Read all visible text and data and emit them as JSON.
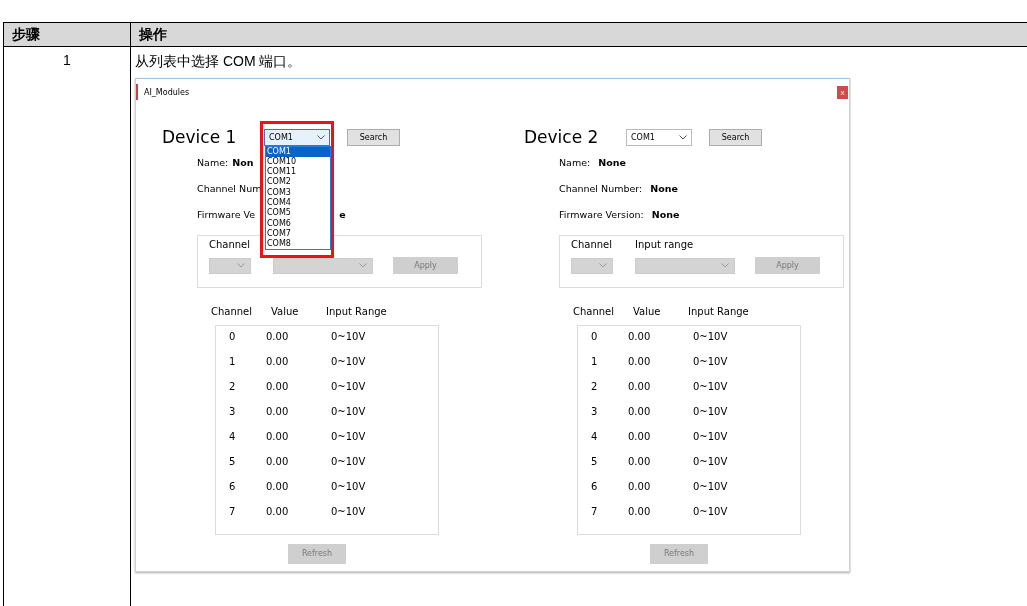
{
  "table": {
    "columns": [
      "步骤",
      "操作"
    ],
    "rows": [
      {
        "step": "1",
        "instruction": "从列表中选择 COM 端口。",
        "screenshot": {
          "window": {
            "title": "AI_Modules",
            "close": "x"
          },
          "devices": [
            {
              "title": "Device 1",
              "port": {
                "value": "COM1",
                "open": true,
                "highlighted": true,
                "options": [
                  {
                    "label": "COM1",
                    "selected": true
                  },
                  {
                    "label": "COM10",
                    "selected": false
                  },
                  {
                    "label": "COM11",
                    "selected": false
                  },
                  {
                    "label": "COM2",
                    "selected": false
                  },
                  {
                    "label": "COM3",
                    "selected": false
                  },
                  {
                    "label": "COM4",
                    "selected": false
                  },
                  {
                    "label": "COM5",
                    "selected": false
                  },
                  {
                    "label": "COM6",
                    "selected": false
                  },
                  {
                    "label": "COM7",
                    "selected": false
                  },
                  {
                    "label": "COM8",
                    "selected": false
                  }
                ]
              },
              "search_button": "Search",
              "info": [
                {
                  "label": "Name:",
                  "value": "Non"
                },
                {
                  "label": "Channel Num"
                },
                {
                  "label": "Firmware Ve",
                  "value": "e",
                  "covered": true
                }
              ],
              "settings": {
                "channel_label": "Channel",
                "apply_button": "Apply"
              },
              "readings": {
                "columns": [
                  "Channel",
                  "Value",
                  "Input Range"
                ],
                "rows": [
                  [
                    "0",
                    "0.00",
                    "0~10V"
                  ],
                  [
                    "1",
                    "0.00",
                    "0~10V"
                  ],
                  [
                    "2",
                    "0.00",
                    "0~10V"
                  ],
                  [
                    "3",
                    "0.00",
                    "0~10V"
                  ],
                  [
                    "4",
                    "0.00",
                    "0~10V"
                  ],
                  [
                    "5",
                    "0.00",
                    "0~10V"
                  ],
                  [
                    "6",
                    "0.00",
                    "0~10V"
                  ],
                  [
                    "7",
                    "0.00",
                    "0~10V"
                  ]
                ]
              },
              "refresh_button": "Refresh"
            },
            {
              "title": "Device 2",
              "port": {
                "value": "COM1",
                "open": false
              },
              "search_button": "Search",
              "info": [
                {
                  "label": "Name:",
                  "value": "None"
                },
                {
                  "label": "Channel Number:",
                  "value": "None"
                },
                {
                  "label": "Firmware Version:",
                  "value": "None"
                }
              ],
              "settings": {
                "channel_label": "Channel",
                "range_label": "Input range",
                "apply_button": "Apply"
              },
              "readings": {
                "columns": [
                  "Channel",
                  "Value",
                  "Input Range"
                ],
                "rows": [
                  [
                    "0",
                    "0.00",
                    "0~10V"
                  ],
                  [
                    "1",
                    "0.00",
                    "0~10V"
                  ],
                  [
                    "2",
                    "0.00",
                    "0~10V"
                  ],
                  [
                    "3",
                    "0.00",
                    "0~10V"
                  ],
                  [
                    "4",
                    "0.00",
                    "0~10V"
                  ],
                  [
                    "5",
                    "0.00",
                    "0~10V"
                  ],
                  [
                    "6",
                    "0.00",
                    "0~10V"
                  ],
                  [
                    "7",
                    "0.00",
                    "0~10V"
                  ]
                ]
              },
              "refresh_button": "Refresh"
            }
          ]
        }
      }
    ]
  }
}
